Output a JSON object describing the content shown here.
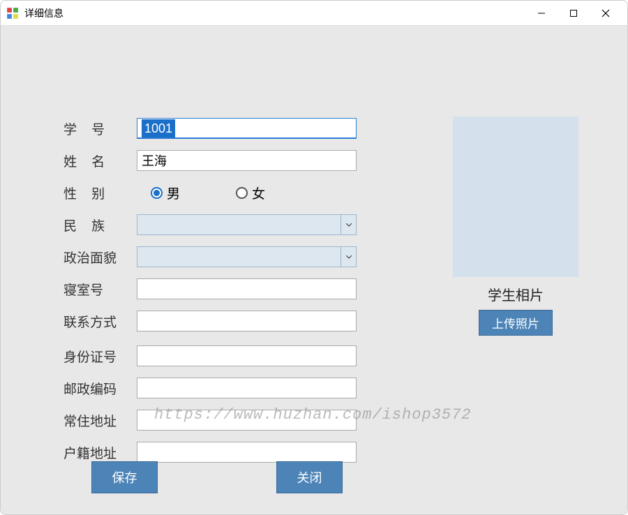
{
  "window": {
    "title": "详细信息"
  },
  "form": {
    "student_id": {
      "label": "学    号",
      "value": "1001"
    },
    "name": {
      "label": "姓    名",
      "value": "王海"
    },
    "gender": {
      "label": "性    别",
      "options": {
        "male": "男",
        "female": "女"
      },
      "selected": "male"
    },
    "ethnicity": {
      "label": "民    族",
      "value": ""
    },
    "political": {
      "label": "政治面貌",
      "value": ""
    },
    "dorm": {
      "label": "寝室号",
      "value": ""
    },
    "contact": {
      "label": "联系方式",
      "value": ""
    },
    "id_card": {
      "label": "身份证号",
      "value": ""
    },
    "postal": {
      "label": "邮政编码",
      "value": ""
    },
    "address": {
      "label": "常住地址",
      "value": ""
    },
    "household": {
      "label": "户籍地址",
      "value": ""
    }
  },
  "photo": {
    "label": "学生相片",
    "upload_label": "上传照片"
  },
  "buttons": {
    "save": "保存",
    "close": "关闭"
  },
  "watermark": "https://www.huzhan.com/ishop3572"
}
